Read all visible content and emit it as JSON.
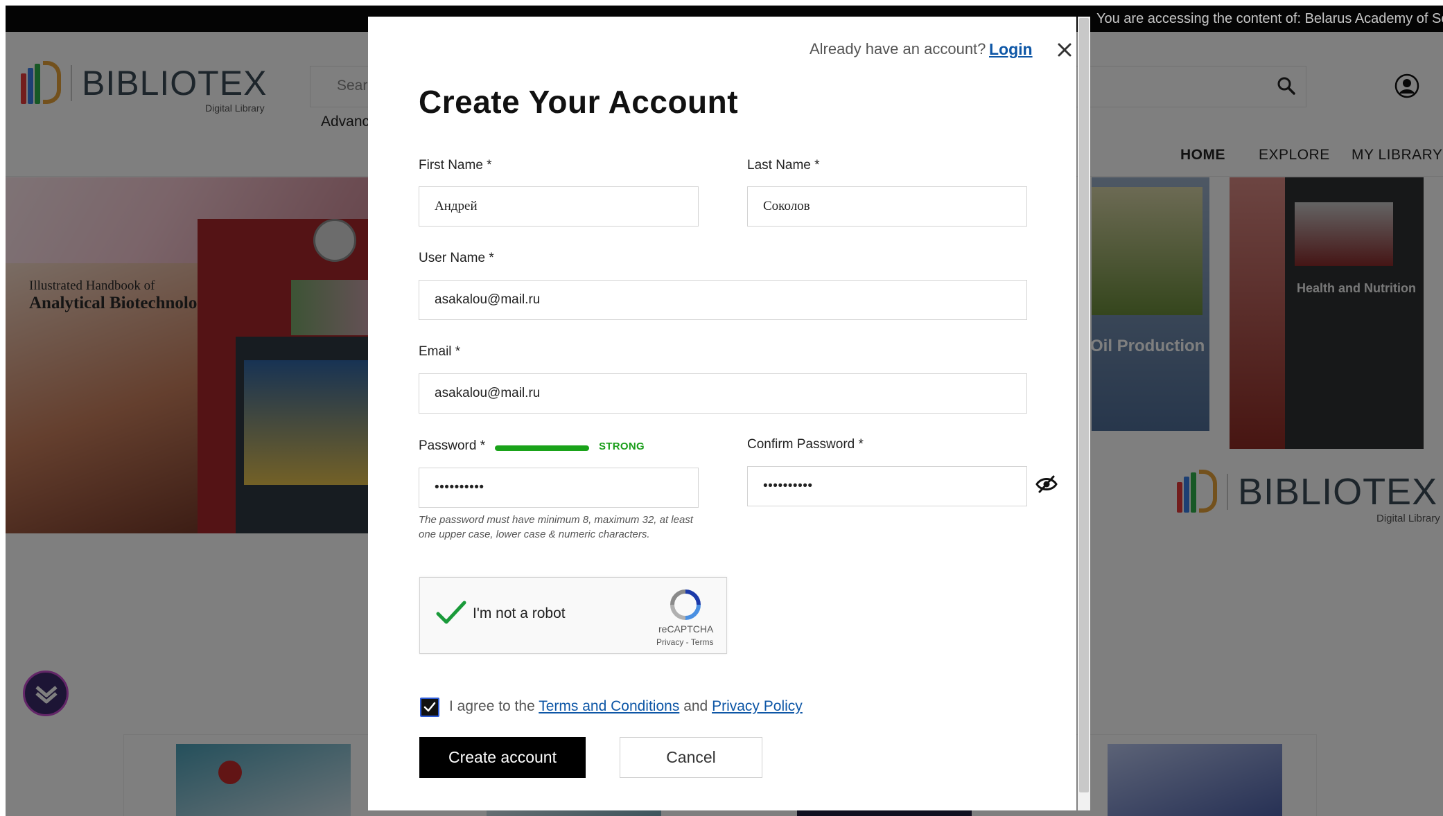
{
  "banner": {
    "text": "You are accessing the content of: Belarus Academy of Sciences"
  },
  "site": {
    "logo_text": "BIBLIOTEX",
    "logo_sub": "Digital Library",
    "search_placeholder": "Search",
    "advanced_label": "Advanced Search",
    "nav": {
      "home": "HOME",
      "explore": "EXPLORE",
      "my_library": "MY LIBRARY"
    }
  },
  "background_books": {
    "book1_line1": "Illustrated Handbook of",
    "book1_line2": "Analytical Biotechnology",
    "book_right1": "Oil Production",
    "book_right2": "Health and Nutrition"
  },
  "modal": {
    "already_text": "Already have an account?",
    "login_label": "Login",
    "title": "Create Your Account",
    "first_name": {
      "label": "First Name *",
      "value": "Андрей"
    },
    "last_name": {
      "label": "Last Name *",
      "value": "Соколов"
    },
    "user_name": {
      "label": "User Name *",
      "value": "asakalou@mail.ru"
    },
    "email": {
      "label": "Email *",
      "value": "asakalou@mail.ru"
    },
    "password": {
      "label": "Password *",
      "value": "••••••••••",
      "strength": "STRONG"
    },
    "confirm_password": {
      "label": "Confirm Password *",
      "value": "••••••••••"
    },
    "password_hint": "The password must have minimum 8, maximum 32, at least one upper case, lower case & numeric characters.",
    "captcha": {
      "label": "I'm not a robot",
      "brand": "reCAPTCHA",
      "links": "Privacy - Terms"
    },
    "agree": {
      "prefix": "I agree to the",
      "terms": "Terms and Conditions",
      "and": "and",
      "privacy": "Privacy Policy"
    },
    "create_button": "Create account",
    "cancel_button": "Cancel"
  },
  "colors": {
    "accent": "#0d56a6",
    "strength": "#1aa31a",
    "overlay": "rgba(0,0,0,0.5)"
  }
}
